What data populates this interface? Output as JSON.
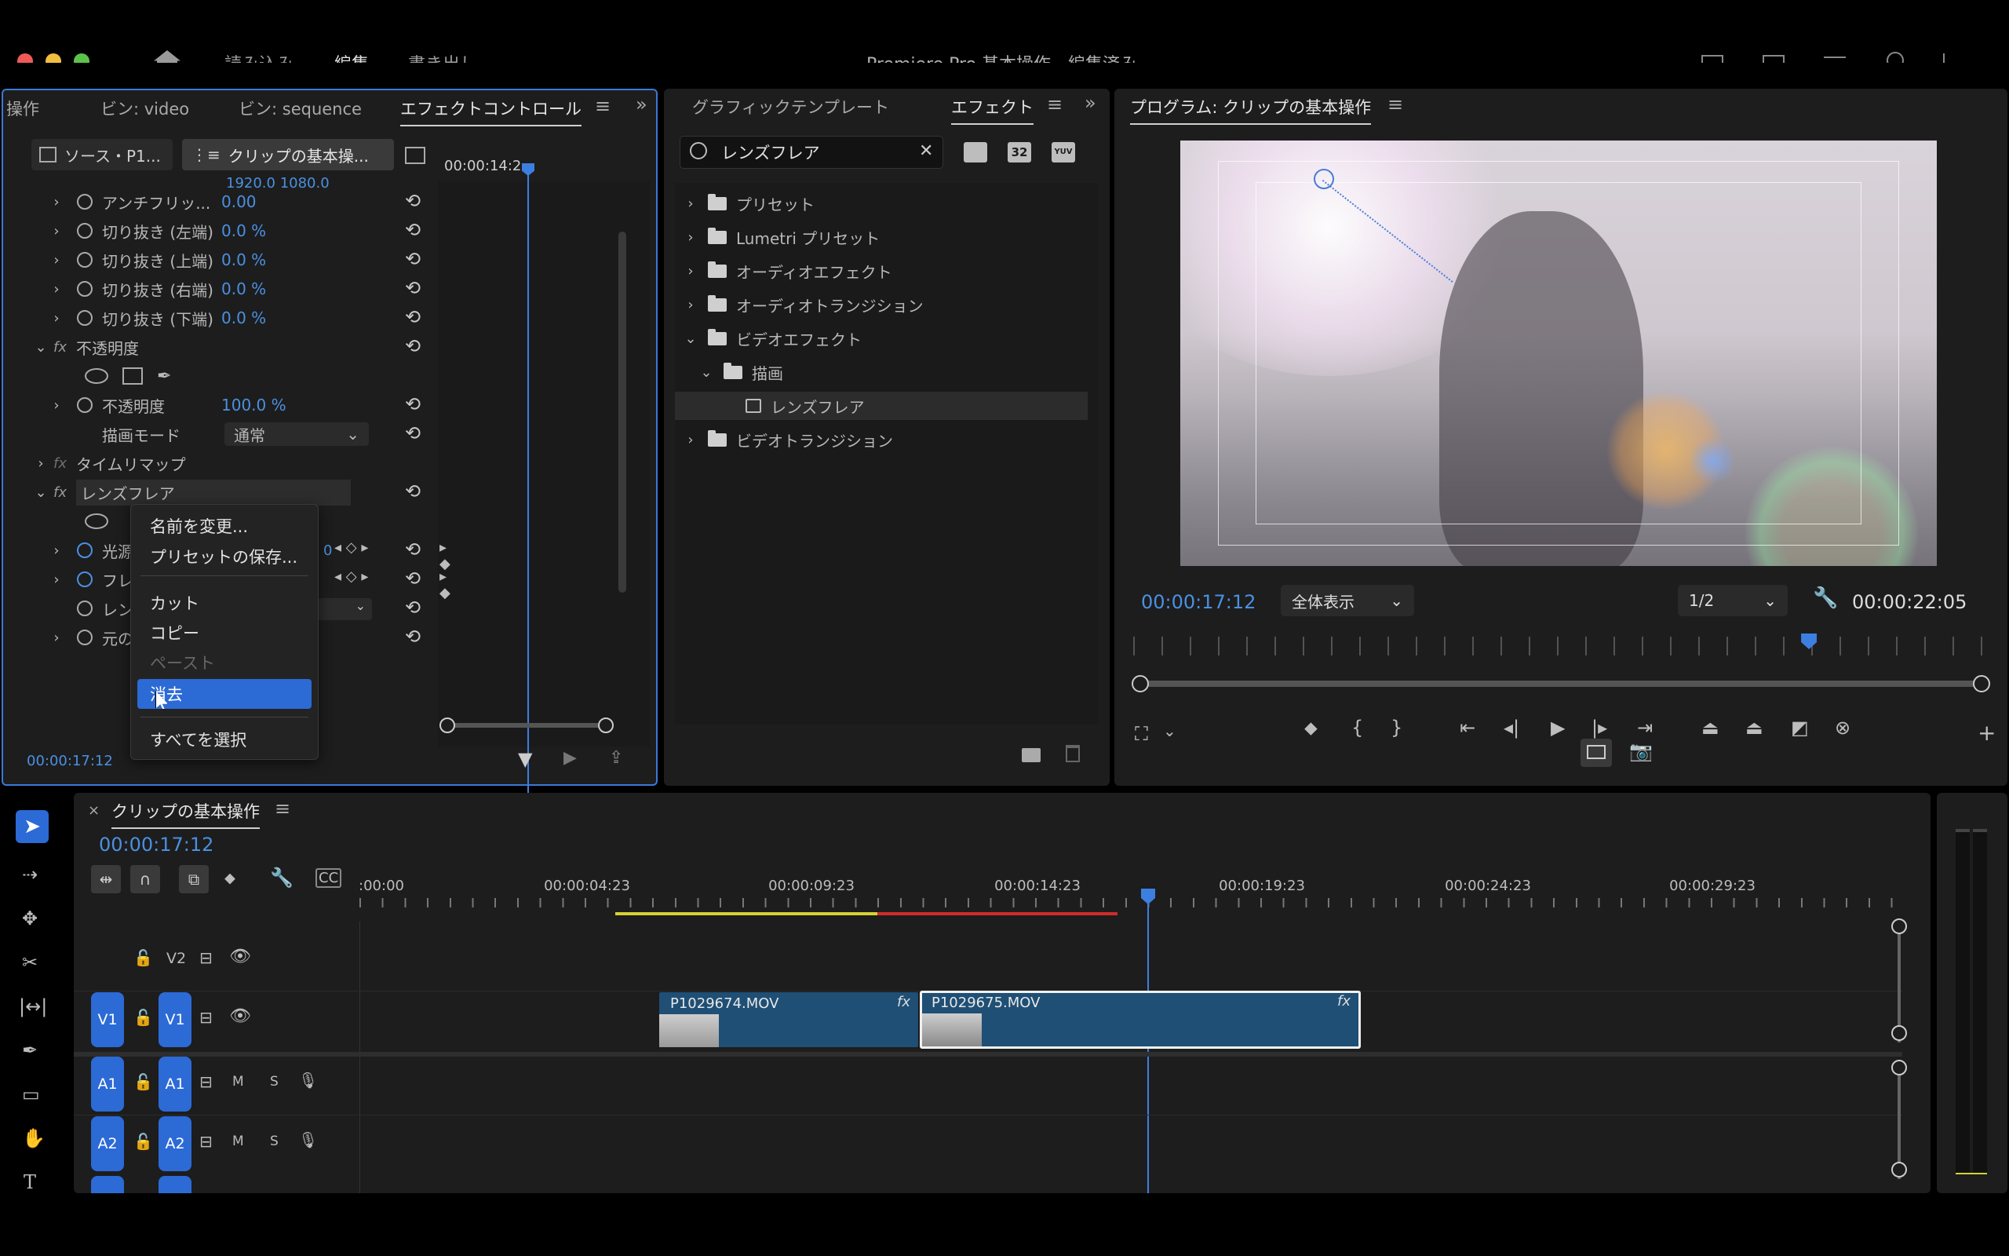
{
  "window": {
    "title": "Premiere Pro 基本操作 - 編集済み",
    "nav_import": "読み込み",
    "nav_edit": "編集",
    "nav_export": "書き出し"
  },
  "colors": {
    "accent": "#4a90e2",
    "highlight": "#2c6ad6",
    "clip": "#1f4f75",
    "in_out_yellow": "#d6d233",
    "render_red": "#d22b2b"
  },
  "left_panel": {
    "tabs": [
      "操作",
      "ビン: video",
      "ビン: sequence",
      "エフェクトコントロール"
    ],
    "source_tab": "ソース・P1...",
    "clip_tab": "クリップの基本操...",
    "timecode_small": "00:00:14:2",
    "partial_row": "1920.0    1080.0",
    "rows": [
      {
        "label": "アンチフリッ...",
        "value": "0.00"
      },
      {
        "label": "切り抜き (左端)",
        "value": "0.0 %"
      },
      {
        "label": "切り抜き (上端)",
        "value": "0.0 %"
      },
      {
        "label": "切り抜き (右端)",
        "value": "0.0 %"
      },
      {
        "label": "切り抜き (下端)",
        "value": "0.0 %"
      }
    ],
    "opacity_group": "不透明度",
    "opacity_label": "不透明度",
    "opacity_value": "100.0 %",
    "blend_label": "描画モード",
    "blend_value": "通常",
    "time_remap": "タイムリマップ",
    "lens_flare": "レンズフレア",
    "lf_row1": "光源",
    "lf_row2": "フレ",
    "lf_row3": "レン",
    "lf_row4": "元の",
    "lf_keyframe_value": "0",
    "fx_label": "fx",
    "bottom_timecode": "00:00:17:12"
  },
  "context_menu": {
    "rename": "名前を変更...",
    "save_preset": "プリセットの保存...",
    "cut": "カット",
    "copy": "コピー",
    "paste": "ペースト",
    "clear": "消去",
    "select_all": "すべてを選択"
  },
  "effects_panel": {
    "tab_graphics": "グラフィックテンプレート",
    "tab_effects": "エフェクト",
    "search_value": "レンズフレア",
    "badge_32": "32",
    "badge_yuv": "YUV",
    "tree": {
      "presets": "プリセット",
      "lumetri": "Lumetri プリセット",
      "audio_effects": "オーディオエフェクト",
      "audio_transitions": "オーディオトランジション",
      "video_effects": "ビデオエフェクト",
      "draw": "描画",
      "lens_flare": "レンズフレア",
      "video_transitions": "ビデオトランジション"
    }
  },
  "program": {
    "title": "プログラム: クリップの基本操作",
    "timecode": "00:00:17:12",
    "zoom": "全体表示",
    "resolution": "1/2",
    "duration": "00:00:22:05",
    "playhead_fraction": 0.79
  },
  "timeline": {
    "title": "クリップの基本操作",
    "timecode": "00:00:17:12",
    "ruler": ":00:00",
    "ticks": [
      "00:00:04:23",
      "00:00:09:23",
      "00:00:14:23",
      "00:00:19:23",
      "00:00:24:23",
      "00:00:29:23"
    ],
    "tracks": {
      "v2": "V2",
      "v1": "V1",
      "a1": "A1",
      "a2": "A2",
      "mute": "M",
      "solo": "S"
    },
    "clips": [
      {
        "name": "P1029674.MOV",
        "fx": "fx"
      },
      {
        "name": "P1029675.MOV",
        "fx": "fx"
      }
    ]
  }
}
